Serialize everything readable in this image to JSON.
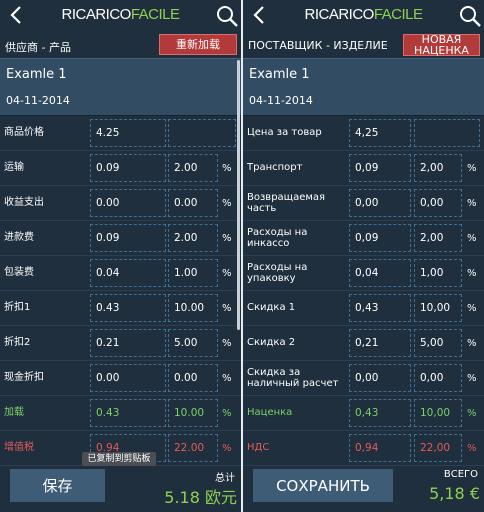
{
  "brand": {
    "part1": "RICARICO",
    "part2": "FACILE"
  },
  "colors": {
    "background": "#1f2f3d",
    "accent_green": "#8fd14f",
    "alert_red": "#b23a3a",
    "field_border": "#3e6e94"
  },
  "icons": {
    "back": "chevron-left-icon",
    "search": "search-icon"
  },
  "left": {
    "subtitle": "供应商 - 产品",
    "red_button": "重新加载",
    "name": "Examle 1",
    "date": "04-11-2014",
    "rows": [
      {
        "label": "商品价格",
        "value": "4.25",
        "pct": "",
        "pct_sign": ""
      },
      {
        "label": "运输",
        "value": "0.09",
        "pct": "2.00",
        "pct_sign": "%"
      },
      {
        "label": "收益支出",
        "value": "0.00",
        "pct": "0.00",
        "pct_sign": "%"
      },
      {
        "label": "进款费",
        "value": "0.09",
        "pct": "2.00",
        "pct_sign": "%"
      },
      {
        "label": "包装费",
        "value": "0.04",
        "pct": "1.00",
        "pct_sign": "%"
      },
      {
        "label": "折扣1",
        "value": "0.43",
        "pct": "10.00",
        "pct_sign": "%"
      },
      {
        "label": "折扣2",
        "value": "0.21",
        "pct": "5.00",
        "pct_sign": "%"
      },
      {
        "label": "现金折扣",
        "value": "0.00",
        "pct": "0.00",
        "pct_sign": "%"
      },
      {
        "label": "加载",
        "value": "0.43",
        "pct": "10.00",
        "pct_sign": "%"
      },
      {
        "label": "增值税",
        "value": "0.94",
        "pct": "22.00",
        "pct_sign": "%"
      }
    ],
    "toast": "已复制到剪贴板",
    "save_label": "保存",
    "total_label": "总计",
    "total_value": "5.18 欧元"
  },
  "right": {
    "subtitle": "ПОСТАВЩИК - ИЗДЕЛИЕ",
    "red_button_line1": "НОВАЯ",
    "red_button_line2": "НАЦЕНКА",
    "name": "Examle 1",
    "date": "04-11-2014",
    "rows": [
      {
        "label": "Цена за товар",
        "value": "4,25",
        "pct": "",
        "pct_sign": ""
      },
      {
        "label": "Транспорт",
        "value": "0,09",
        "pct": "2,00",
        "pct_sign": "%"
      },
      {
        "label": "Возвращаемая часть",
        "value": "0,00",
        "pct": "0,00",
        "pct_sign": "%"
      },
      {
        "label": "Расходы на инкассо",
        "value": "0,09",
        "pct": "2,00",
        "pct_sign": "%"
      },
      {
        "label": "Расходы на упаковку",
        "value": "0,04",
        "pct": "1,00",
        "pct_sign": "%"
      },
      {
        "label": "Скидка 1",
        "value": "0,43",
        "pct": "10,00",
        "pct_sign": "%"
      },
      {
        "label": "Скидка 2",
        "value": "0,21",
        "pct": "5,00",
        "pct_sign": "%"
      },
      {
        "label": "Скидка за наличный расчет",
        "value": "0,00",
        "pct": "0,00",
        "pct_sign": "%"
      },
      {
        "label": "Наценка",
        "value": "0,43",
        "pct": "10,00",
        "pct_sign": "%"
      },
      {
        "label": "НДС",
        "value": "0,94",
        "pct": "22,00",
        "pct_sign": "%"
      }
    ],
    "save_label": "СОХРАНИТЬ",
    "total_label": "ВСЕГО",
    "total_value": "5,18 €"
  }
}
